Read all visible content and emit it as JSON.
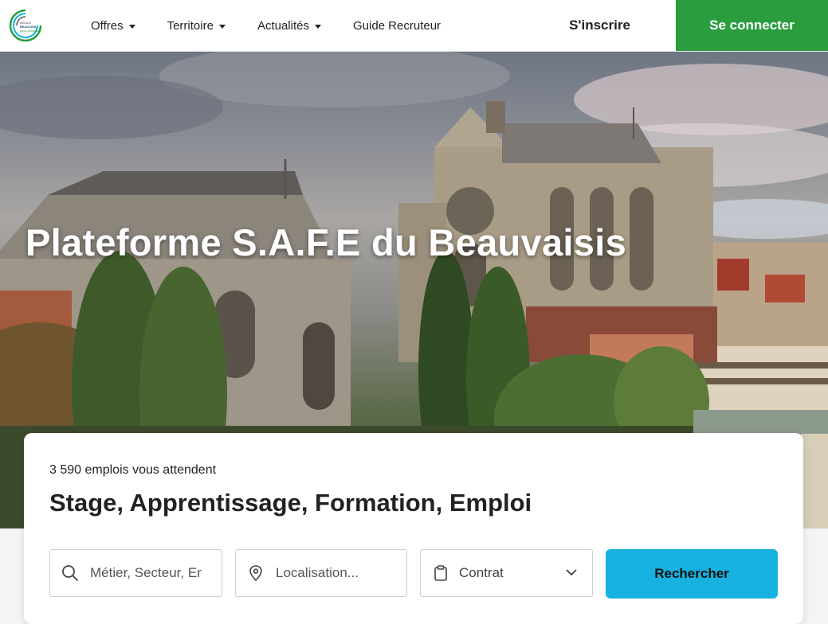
{
  "nav": {
    "logo_lines": [
      "AGGLO",
      "BEAUVAIS",
      "DÉVELOPPEMENT"
    ],
    "menu": [
      {
        "label": "Offres",
        "dropdown": true
      },
      {
        "label": "Territoire",
        "dropdown": true
      },
      {
        "label": "Actualités",
        "dropdown": true
      },
      {
        "label": "Guide Recruteur",
        "dropdown": false
      }
    ],
    "signup_label": "S'inscrire",
    "login_label": "Se connecter"
  },
  "hero": {
    "title": "Plateforme S.A.F.E du Beauvaisis",
    "image": "cathedral-photo"
  },
  "search": {
    "count_text": "3 590 emplois vous attendent",
    "title": "Stage, Apprentissage, Formation, Emploi",
    "job_placeholder": "Métier, Secteur, Entreprise",
    "location_placeholder": "Localisation...",
    "contract_label": "Contrat",
    "submit_label": "Rechercher"
  },
  "colors": {
    "login_bg": "#2a9d3f",
    "search_button": "#17b2e0",
    "text": "#222222"
  }
}
